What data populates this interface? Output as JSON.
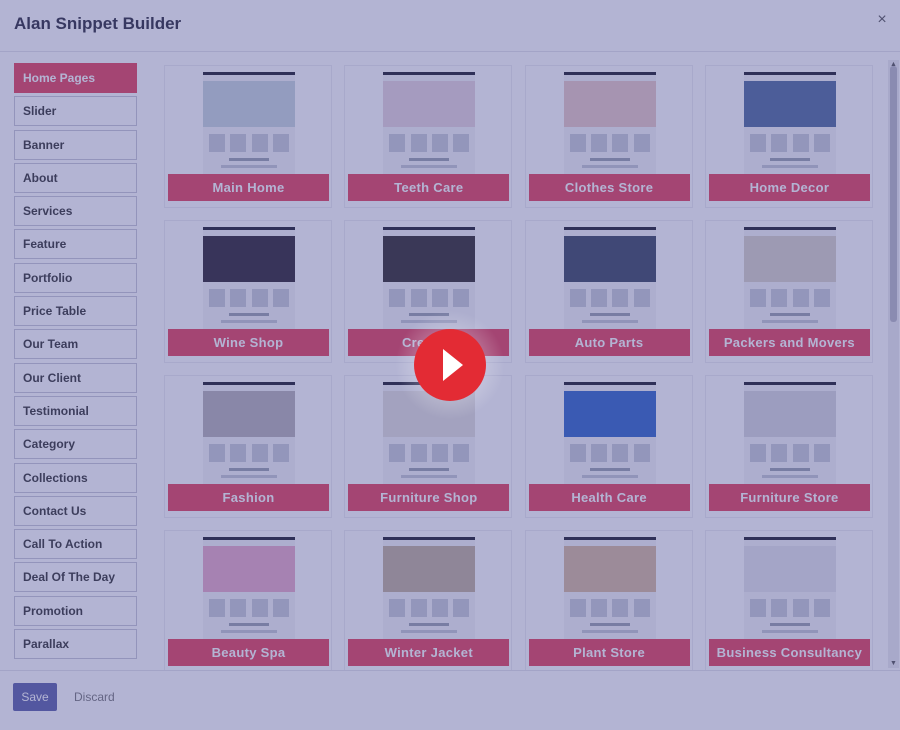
{
  "header": {
    "title": "Alan Snippet Builder",
    "close_label": "×"
  },
  "sidebar": {
    "items": [
      {
        "label": "Home Pages",
        "active": true
      },
      {
        "label": "Slider"
      },
      {
        "label": "Banner"
      },
      {
        "label": "About"
      },
      {
        "label": "Services"
      },
      {
        "label": "Feature"
      },
      {
        "label": "Portfolio"
      },
      {
        "label": "Price Table"
      },
      {
        "label": "Our Team"
      },
      {
        "label": "Our Client"
      },
      {
        "label": "Testimonial"
      },
      {
        "label": "Category"
      },
      {
        "label": "Collections"
      },
      {
        "label": "Contact Us"
      },
      {
        "label": "Call To Action"
      },
      {
        "label": "Deal Of The Day"
      },
      {
        "label": "Promotion"
      },
      {
        "label": "Parallax"
      }
    ]
  },
  "templates": [
    {
      "label": "Main Home",
      "color": "#c9d6dc"
    },
    {
      "label": "Teeth Care",
      "color": "#e7d4dc"
    },
    {
      "label": "Clothes Store",
      "color": "#e9c9c4"
    },
    {
      "label": "Home Decor",
      "color": "#4f6a9c"
    },
    {
      "label": "Wine Shop",
      "color": "#2c2430"
    },
    {
      "label": "Creative",
      "color": "#2f2a2a"
    },
    {
      "label": "Auto Parts",
      "color": "#3a4660"
    },
    {
      "label": "Packers and Movers",
      "color": "#d9d2c8"
    },
    {
      "label": "Fashion",
      "color": "#b7b1b6"
    },
    {
      "label": "Furniture Shop",
      "color": "#e4e1dc"
    },
    {
      "label": "Health Care",
      "color": "#2f64c8"
    },
    {
      "label": "Furniture Store",
      "color": "#d8d8dc"
    },
    {
      "label": "Beauty Spa",
      "color": "#e9a9c6"
    },
    {
      "label": "Winter Jacket",
      "color": "#c2b09a"
    },
    {
      "label": "Plant Store",
      "color": "#d8b89c"
    },
    {
      "label": "Business Consultancy",
      "color": "#e6e6ea"
    }
  ],
  "footer": {
    "save_label": "Save",
    "discard_label": "Discard"
  },
  "accent_color": "#e6415b",
  "video_icon": "play-button-icon"
}
